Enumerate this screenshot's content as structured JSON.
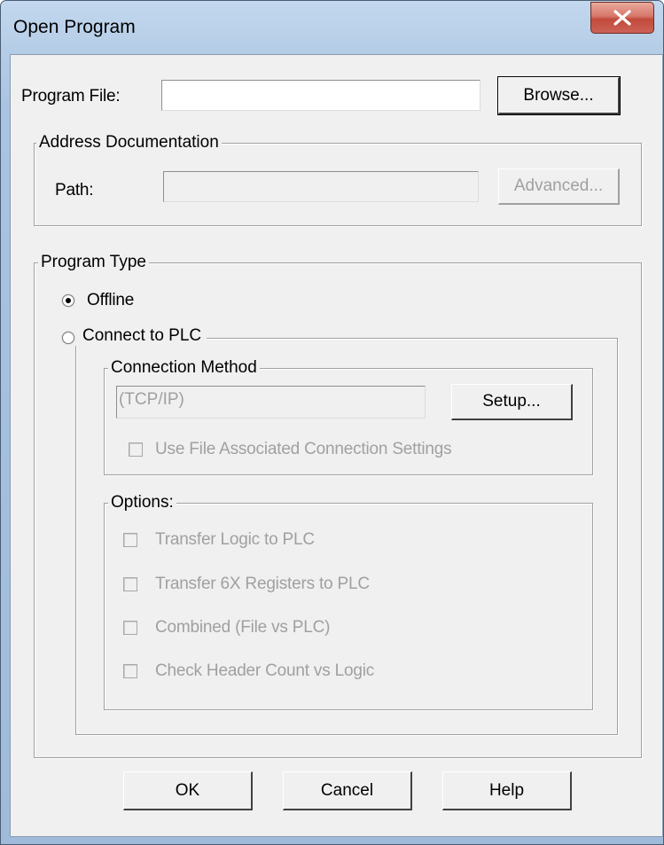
{
  "window": {
    "title": "Open Program"
  },
  "program_file": {
    "label": "Program File:",
    "value": "",
    "browse_label": "Browse..."
  },
  "address_documentation": {
    "legend": "Address Documentation",
    "path_label": "Path:",
    "path_value": "",
    "advanced_label": "Advanced..."
  },
  "program_type": {
    "legend": "Program Type",
    "offline_label": "Offline",
    "offline_selected": true,
    "connect_label": "Connect to PLC",
    "connect_selected": false
  },
  "connection_method": {
    "legend": "Connection Method",
    "value": "(TCP/IP)",
    "setup_label": "Setup...",
    "use_file_settings_label": "Use File Associated Connection Settings",
    "use_file_settings_checked": false
  },
  "options": {
    "legend": "Options:",
    "items": [
      {
        "label": "Transfer Logic to PLC",
        "checked": false
      },
      {
        "label": "Transfer 6X Registers to PLC",
        "checked": false
      },
      {
        "label": "Combined (File vs PLC)",
        "checked": false
      },
      {
        "label": "Check Header Count vs Logic",
        "checked": false
      }
    ]
  },
  "footer": {
    "ok_label": "OK",
    "cancel_label": "Cancel",
    "help_label": "Help"
  },
  "colors": {
    "frame": "#b4cce6",
    "client": "#f0f0f0",
    "close": "#c14a3c",
    "disabled_text": "#a0a0a0"
  }
}
